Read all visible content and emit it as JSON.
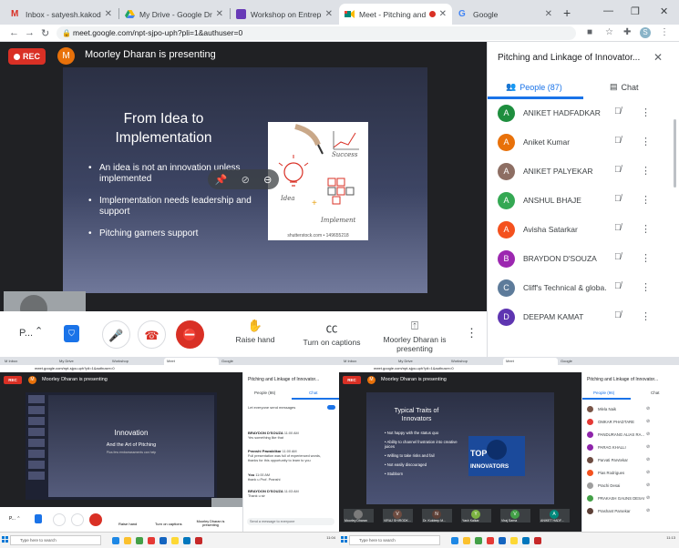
{
  "browser": {
    "tabs": [
      {
        "label": "Inbox - satyesh.kakodkar@",
        "icon": "gmail-icon",
        "color": "#d93025"
      },
      {
        "label": "My Drive - Google Drive",
        "icon": "drive-icon",
        "color": "#1fa463"
      },
      {
        "label": "Workshop on Entrepreneur",
        "icon": "forms-icon",
        "color": "#673ab7"
      },
      {
        "label": "Meet - Pitching and Lin",
        "icon": "meet-icon",
        "color": "#00897b"
      },
      {
        "label": "Google",
        "icon": "google-icon",
        "color": "#4285f4"
      }
    ],
    "url": "meet.google.com/npt-sjpo-uph?pli=1&authuser=0",
    "profile_initial": "S"
  },
  "meet": {
    "rec_label": "REC",
    "presenter_initial": "M",
    "presenting_text": "Moorley Dharan is presenting",
    "slide": {
      "title": "From Idea to Implementation",
      "bullets": [
        "An idea is not an innovation unless implemented",
        "Implementation needs leadership and support",
        "Pitching garners support"
      ],
      "image_words": {
        "success": "Success",
        "idea": "Idea",
        "implement": "Implement"
      },
      "image_caption": "shutterstock.com • 149655218"
    }
  },
  "controls": {
    "meeting_name": "P...",
    "raise_hand": "Raise hand",
    "captions": "Turn on captions",
    "present": "Moorley Dharan is presenting"
  },
  "panel": {
    "title": "Pitching and Linkage of Innovator...",
    "people_tab": "People (87)",
    "chat_tab": "Chat",
    "people": [
      {
        "initial": "A",
        "name": "ANIKET HADFADKAR",
        "color": "#1e8e3e"
      },
      {
        "initial": "A",
        "name": "Aniket Kumar",
        "color": "#e8710a"
      },
      {
        "initial": "A",
        "name": "ANIKET PALYEKAR",
        "color": "#8d6e63"
      },
      {
        "initial": "A",
        "name": "ANSHUL BHAJE",
        "color": "#34a853"
      },
      {
        "initial": "A",
        "name": "Avisha Satarkar",
        "color": "#f4511e"
      },
      {
        "initial": "B",
        "name": "BRAYDON D'SOUZA",
        "color": "#9c27b0"
      },
      {
        "initial": "C",
        "name": "Cliff's Technical & globa...",
        "color": "#5d7b9a"
      },
      {
        "initial": "D",
        "name": "DEEPAM KAMAT",
        "color": "#5e35b1"
      }
    ]
  },
  "mini_left": {
    "rec": "REC",
    "presenting_text": "Moorley Dharan is presenting",
    "slide_title": "Innovation",
    "slide_sub": "And the Art of Pitching",
    "slide_small": "Plus few embarrassments can help",
    "panel_title": "Pitching and Linkage of Innovator...",
    "people_tab": "People (86)",
    "chat_tab": "Chat",
    "chat_toggle": "Let everyone send messages",
    "messages": [
      {
        "who": "BRAYDON D'SOUZA",
        "time": "11:00 AM",
        "text": "Yes something like that"
      },
      {
        "who": "Pranshi Pawaldikar",
        "time": "11:00 AM",
        "text": "Full presentation was full of experienced words, thanks for this opportunity to learn to you"
      },
      {
        "who": "You",
        "time": "11:00 AM",
        "text": "thank u Prof. Pranshi"
      },
      {
        "who": "BRAYDON D'SOUZA",
        "time": "11:03 AM",
        "text": "Thank u sir"
      }
    ],
    "chat_placeholder": "Send a message to everyone",
    "raise": "Raise hand",
    "captions": "Turn on captions",
    "present": "Moorley Dharan is presenting",
    "search": "Type here to search",
    "clock": "11:04"
  },
  "mini_right": {
    "rec": "REC",
    "presenting_text": "Moorley Dharan is presenting",
    "slide_title": "Typical Traits of Innovators",
    "bullets": [
      "Not happy with the status quo",
      "Ability to channel frustration into creative juices",
      "Willing to take risks and fail",
      "Not easily discouraged",
      "Stubborn"
    ],
    "logo_top": "TOP",
    "logo_bottom": "INNOVATORS",
    "panel_title": "Pitching and Linkage of Innovator...",
    "people_tab": "People (96)",
    "chat_tab": "Chat",
    "people": [
      {
        "name": "Mlela Naik",
        "color": "#795548"
      },
      {
        "name": "OMKAR PHADTARE",
        "color": "#e53935"
      },
      {
        "name": "PANDURANG ALIAS RA...",
        "color": "#8e24aa"
      },
      {
        "name": "PARAG KHALLI",
        "color": "#8e24aa"
      },
      {
        "name": "Parvati Parvtekar",
        "color": "#6d4c41"
      },
      {
        "name": "Pias Rodrigues",
        "color": "#f4511e"
      },
      {
        "name": "Prachi Desai",
        "color": "#9e9e9e"
      },
      {
        "name": "PRAKASH GAUNS DESAI",
        "color": "#43a047"
      },
      {
        "name": "Prashant Parsekar",
        "color": "#5d4037"
      }
    ],
    "tiles": [
      {
        "initial": "",
        "name": "Moorley Dharan",
        "color": "#7b7b7b"
      },
      {
        "initial": "V",
        "name": "VIRAJ SHIRODK...",
        "color": "#6d4c41"
      },
      {
        "initial": "N",
        "name": "Dr. Kuldeep M...",
        "color": "#5d4037"
      },
      {
        "initial": "Y",
        "name": "Yash Kalkar",
        "color": "#7cb342"
      },
      {
        "initial": "V",
        "name": "Viraj Sarna",
        "color": "#43a047"
      },
      {
        "initial": "A",
        "name": "ANIKET HADF...",
        "color": "#00897b"
      }
    ],
    "search": "Type here to search",
    "clock": "11:13"
  }
}
